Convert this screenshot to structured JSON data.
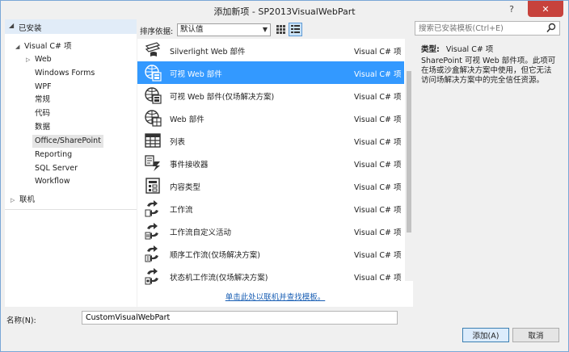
{
  "window": {
    "title": "添加新项 - SP2013VisualWebPart",
    "help": "?",
    "close": "✕"
  },
  "tree": {
    "installed": "已安装",
    "root": "Visual C# 项",
    "items": [
      "Web",
      "Windows Forms",
      "WPF",
      "常规",
      "代码",
      "数据",
      "Office/SharePoint",
      "Reporting",
      "SQL Server",
      "Workflow"
    ],
    "online": "联机"
  },
  "toolbar": {
    "sort_label": "排序依据:",
    "sort_value": "默认值"
  },
  "search": {
    "placeholder": "搜索已安装模板(Ctrl+E)"
  },
  "templates": [
    {
      "name": "Silverlight Web 部件",
      "lang": "Visual C# 项",
      "icon": "silverlight-webpart-icon"
    },
    {
      "name": "可视 Web 部件",
      "lang": "Visual C# 项",
      "icon": "visual-webpart-icon"
    },
    {
      "name": "可视 Web 部件(仅场解决方案)",
      "lang": "Visual C# 项",
      "icon": "visual-webpart-farm-icon"
    },
    {
      "name": "Web 部件",
      "lang": "Visual C# 项",
      "icon": "webpart-icon"
    },
    {
      "name": "列表",
      "lang": "Visual C# 项",
      "icon": "list-icon"
    },
    {
      "name": "事件接收器",
      "lang": "Visual C# 项",
      "icon": "event-receiver-icon"
    },
    {
      "name": "内容类型",
      "lang": "Visual C# 项",
      "icon": "content-type-icon"
    },
    {
      "name": "工作流",
      "lang": "Visual C# 项",
      "icon": "workflow-icon"
    },
    {
      "name": "工作流自定义活动",
      "lang": "Visual C# 项",
      "icon": "workflow-activity-icon"
    },
    {
      "name": "顺序工作流(仅场解决方案)",
      "lang": "Visual C# 项",
      "icon": "sequential-workflow-icon"
    },
    {
      "name": "状态机工作流(仅场解决方案)",
      "lang": "Visual C# 项",
      "icon": "state-machine-workflow-icon"
    }
  ],
  "online_link": "单击此处以联机并查找模板。",
  "details": {
    "type_label": "类型:",
    "type_value": "Visual C# 项",
    "description": "SharePoint 可视 Web 部件项。此项可在场或沙盒解决方案中使用，但它无法访问场解决方案中的完全信任资源。"
  },
  "bottom": {
    "name_label": "名称(N):",
    "name_value": "CustomVisualWebPart",
    "add": "添加(A)",
    "cancel": "取消"
  },
  "colors": {
    "selected": "#3399ff",
    "hover": "#cce4f7",
    "link": "#1a5fb4",
    "accent": "#7aa7d6"
  }
}
